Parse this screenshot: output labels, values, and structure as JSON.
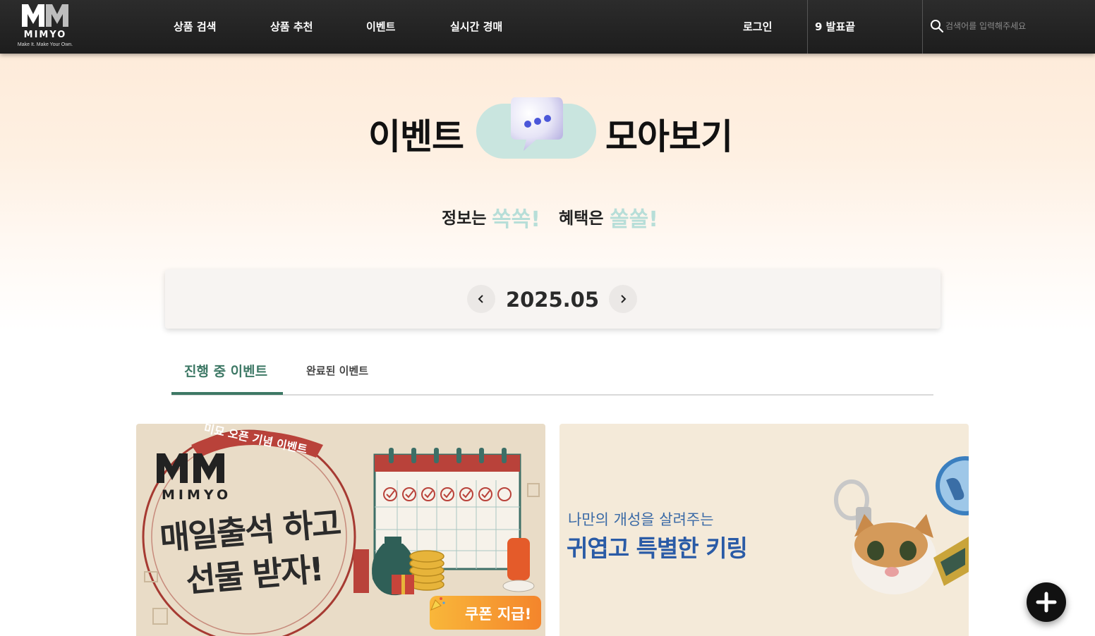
{
  "header": {
    "logo": {
      "mark": "MM",
      "brand": "MIMYO",
      "tagline": "Make It.  Make Your Own."
    },
    "nav": [
      {
        "label": "상품 검색"
      },
      {
        "label": "상품 추천"
      },
      {
        "label": "이벤트"
      },
      {
        "label": "실시간 경매"
      }
    ],
    "login_label": "로그인",
    "user_label": "9 발표끝",
    "search": {
      "placeholder": "검색어를 입력해주세요",
      "icon": "search-icon"
    }
  },
  "hero": {
    "title_left": "이벤트",
    "title_right": "모아보기",
    "bubble_icon": "chat-bubble-icon",
    "subtitle_a": "정보는",
    "subtitle_a_accent": "쏙쏙!",
    "subtitle_b": "혜택은",
    "subtitle_b_accent": "쏠쏠!"
  },
  "month_selector": {
    "current": "2025.05",
    "prev_icon": "chevron-left-icon",
    "next_icon": "chevron-right-icon"
  },
  "tabs": [
    {
      "label": "진행 중 이벤트",
      "active": true
    },
    {
      "label": "완료된 이벤트",
      "active": false
    }
  ],
  "events": [
    {
      "ribbon": "미묘 오픈 기념 이벤트",
      "brand_mark": "MM",
      "brand": "MIMYO",
      "headline_1": "매일출석 하고",
      "headline_2": "선물 받자!",
      "badge": "쿠폰 지급!"
    },
    {
      "subtitle": "나만의 개성을 살려주는",
      "headline": "귀엽고 특별한 키링"
    }
  ],
  "fab": {
    "icon": "plus-icon"
  },
  "colors": {
    "header_bg": "#222222",
    "accent_mint": "#b7ded8",
    "tab_active": "#3d7865",
    "keyring_blue": "#2a5ba6"
  }
}
